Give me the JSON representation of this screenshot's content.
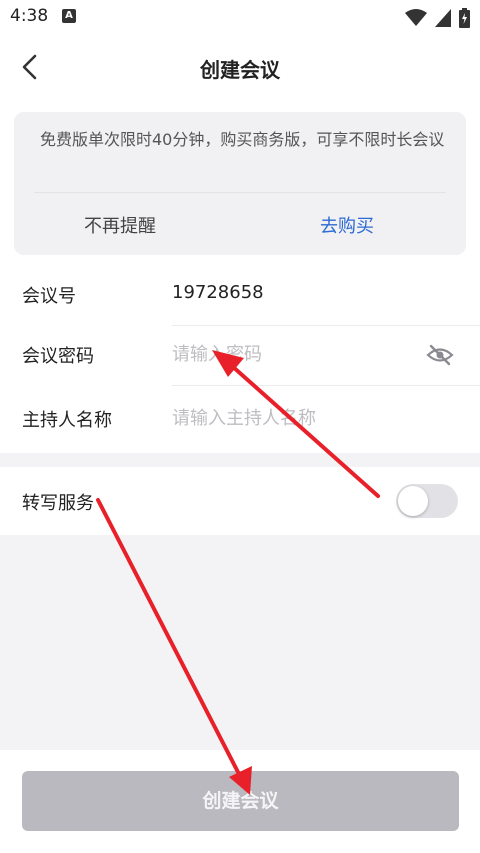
{
  "status_bar": {
    "time": "4:38",
    "notification_badge": "A",
    "icons": [
      "wifi-icon",
      "signal-icon",
      "battery-charging-icon"
    ]
  },
  "nav": {
    "title": "创建会议",
    "back_icon": "chevron-left-icon"
  },
  "promo": {
    "text": "免费版单次限时40分钟，购买商务版，可享不限时长会议",
    "dismiss_label": "不再提醒",
    "buy_label": "去购买",
    "buy_color": "#2d6ad3"
  },
  "form": {
    "meeting_id_label": "会议号",
    "meeting_id_value": "19728658",
    "password_label": "会议密码",
    "password_placeholder": "请输入密码",
    "password_visibility_icon": "eye-off-icon",
    "host_name_label": "主持人名称",
    "host_name_placeholder": "请输入主持人名称"
  },
  "transcription": {
    "label": "转写服务",
    "enabled": false
  },
  "footer": {
    "create_label": "创建会议",
    "button_color": "#b9b9bf"
  },
  "annotation": {
    "arrow_color": "#e8202a"
  }
}
